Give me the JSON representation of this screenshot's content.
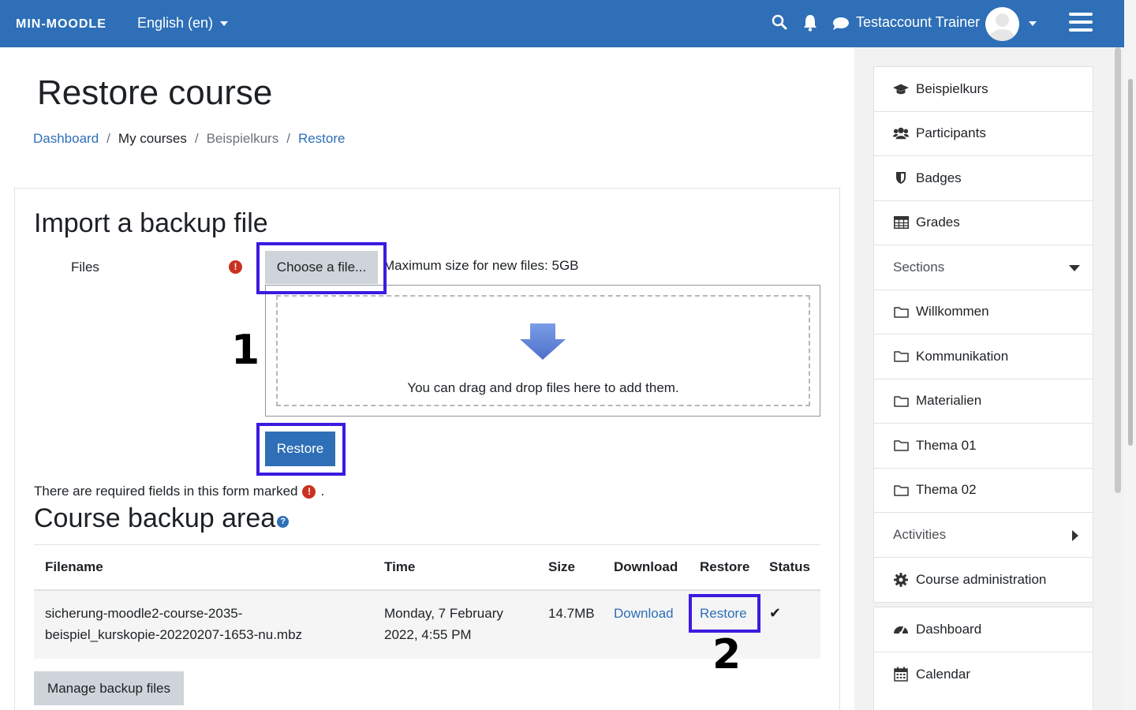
{
  "navbar": {
    "brand": "MIN-MOODLE",
    "language": "English (en)",
    "username": "Testaccount Trainer",
    "icons": [
      "search-icon",
      "bell-icon",
      "chat-icon",
      "hamburger-icon"
    ]
  },
  "header": {
    "title": "Restore course",
    "breadcrumb": [
      "Dashboard",
      "My courses",
      "Beispielkurs",
      "Restore"
    ]
  },
  "import": {
    "title": "Import a backup file",
    "files_label": "Files",
    "choose_button": "Choose a file...",
    "max_size": "Maximum size for new files: 5GB",
    "drop_text": "You can drag and drop files here to add them.",
    "restore_button": "Restore",
    "required_note": "There are required fields in this form marked",
    "required_note_end": "."
  },
  "annotations": {
    "one": "1",
    "two": "2",
    "highlight_color": "#3d1ae0"
  },
  "backup_area": {
    "title": "Course backup area",
    "columns": [
      "Filename",
      "Time",
      "Size",
      "Download",
      "Restore",
      "Status"
    ],
    "row": {
      "filename_line1": "sicherung-moodle2-course-2035-",
      "filename_line2": "beispiel_kurskopie-20220207-1653-nu.mbz",
      "time_line1": "Monday, 7 February",
      "time_line2": "2022, 4:55 PM",
      "size": "14.7MB",
      "download": "Download",
      "restore": "Restore",
      "status": "✔"
    },
    "manage_button": "Manage backup files"
  },
  "sidebar": {
    "course_block": [
      {
        "label": "Beispielkurs",
        "icon": "graduation-cap-icon"
      },
      {
        "label": "Participants",
        "icon": "users-icon"
      },
      {
        "label": "Badges",
        "icon": "shield-icon"
      },
      {
        "label": "Grades",
        "icon": "table-icon"
      },
      {
        "label": "Sections",
        "icon": "caret-down-icon"
      },
      {
        "label": "Willkommen",
        "icon": "folder-icon"
      },
      {
        "label": "Kommunikation",
        "icon": "folder-icon"
      },
      {
        "label": "Materialien",
        "icon": "folder-icon"
      },
      {
        "label": "Thema 01",
        "icon": "folder-icon"
      },
      {
        "label": "Thema 02",
        "icon": "folder-icon"
      },
      {
        "label": "Activities",
        "icon": "caret-right-icon"
      },
      {
        "label": "Course administration",
        "icon": "gear-icon"
      }
    ],
    "nav_block": [
      {
        "label": "Dashboard",
        "icon": "dashboard-icon"
      },
      {
        "label": "Calendar",
        "icon": "calendar-icon"
      }
    ]
  },
  "colors": {
    "navbar": "#2e6fb7",
    "link": "#2e6fb7",
    "required": "#ca3120"
  }
}
